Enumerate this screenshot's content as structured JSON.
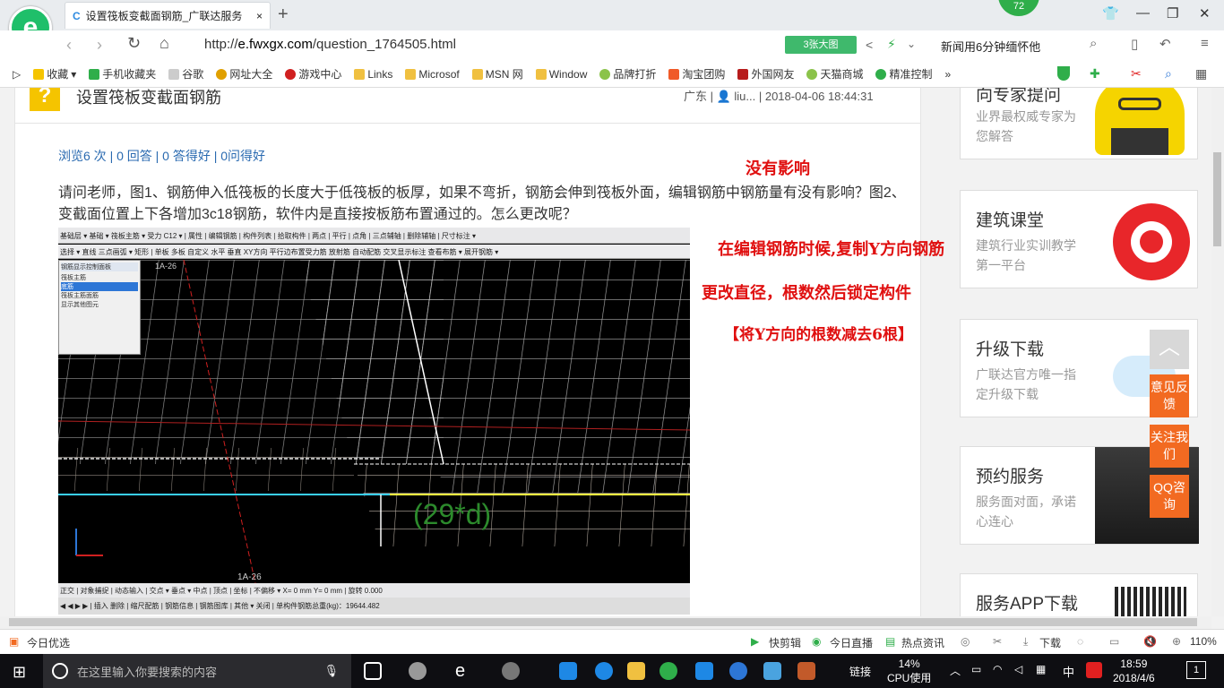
{
  "browser": {
    "tab_title": "设置筏板变截面钢筋_广联达服务",
    "tab_close": "×",
    "new_tab": "+",
    "badge_number": "72",
    "url_prefix": "http://",
    "url_domain": "e.fwxgx.com",
    "url_path": "/question_1764505.html",
    "big_pic_label": "3张大图",
    "news_ticker": "新闻用6分钟缅怀他",
    "bookmarks": [
      "收藏",
      "手机收藏夹",
      "谷歌",
      "网址大全",
      "游戏中心",
      "Links",
      "Microsof",
      "MSN 网",
      "Window",
      "品牌打折",
      "淘宝团购",
      "外国网友",
      "天猫商城",
      "精准控制"
    ],
    "bookmarks_more": "»"
  },
  "question": {
    "title": "设置筏板变截面钢筋",
    "meta": "广东 | 👤 liu... | 2018-04-06 18:44:31",
    "stats": "浏览6 次 | 0 回答 | 0 答得好 | 0问得好",
    "body": "请问老师，图1、钢筋伸入低筏板的长度大于低筏板的板厚，如果不弯折，钢筋会伸到筏板外面，编辑钢筋中钢筋量有没有影响？图2、变截面位置上下各增加3c18钢筋，软件内是直接按板筋布置通过的。怎么更改呢？"
  },
  "annotations": {
    "line1": "没有影响",
    "line2": "在编辑钢筋时候,复制Y方向钢筋",
    "line3": "更改直径，根数然后锁定构件",
    "line4": "【将Y方向的根数减去6根】"
  },
  "embedded": {
    "toolbar1": "基础层 ▾ 基础 ▾ 筏板主筋 ▾ 受力 C12 ▾ | 属性 | 编辑钢筋 | 构件列表 | 拾取构件 | 两点 | 平行 | 点角 | 三点辅轴 | 删除辅轴 | 尺寸标注 ▾",
    "toolbar2": "选择 ▾ 直线 三点画弧 ▾ 矩形 | 单板 多板 自定义 水平 垂直 XY方向 平行边布置受力筋 放射筋 自动配筋 交叉显示标注 查看布筋 ▾ 展开钢筋 ▾",
    "panel_title": "钢筋显示控制面板",
    "panel_items": [
      "筏板主筋",
      "底筋",
      "筏板主筋面筋",
      "显示其他图元"
    ],
    "axis_top": "1A-26",
    "axis_bottom": "1A-26",
    "length_label": "(29*d)",
    "statusbar1": "正交 | 对象捕捉 | 动态输入 | 交点 ▾ 垂点 ▾ 中点 | 顶点 | 坐标 | 不偏移 ▾ X= 0 mm Y= 0 mm | 旋转 0.000",
    "statusbar2": "◀ ◀ ▶ ▶ | 插入 删除 | 缩尺配筋 | 钢筋信息 | 钢筋图库 | 其他 ▾ 关闭 | 单构件钢筋总重(kg)：19644.482"
  },
  "sidebar": [
    {
      "title": "向专家提问",
      "sub": "业界最权威专家为您解答"
    },
    {
      "title": "建筑课堂",
      "sub": "建筑行业实训教学第一平台"
    },
    {
      "title": "升级下载",
      "sub": "广联达官方唯一指定升级下载"
    },
    {
      "title": "预约服务",
      "sub": "服务面对面，承诺心连心"
    },
    {
      "title": "服务APP下载",
      "sub": ""
    }
  ],
  "float_tags": [
    "意见反馈",
    "关注我们",
    "QQ咨询"
  ],
  "statusbar": {
    "left": "今日优选",
    "items": [
      "快剪辑",
      "今日直播",
      "热点资讯",
      "下载"
    ],
    "zoom": "110%"
  },
  "taskbar": {
    "search_placeholder": "在这里输入你要搜索的内容",
    "link_label": "链接",
    "cpu_value": "14%",
    "cpu_label": "CPU使用",
    "ime": "中",
    "time": "18:59",
    "date": "2018/4/6",
    "notifications": "1"
  },
  "colors": {
    "accent_green": "#1fbf6a",
    "annotation_red": "#e01010",
    "tag_orange": "#f26a21",
    "link_blue": "#2a6ab0"
  }
}
